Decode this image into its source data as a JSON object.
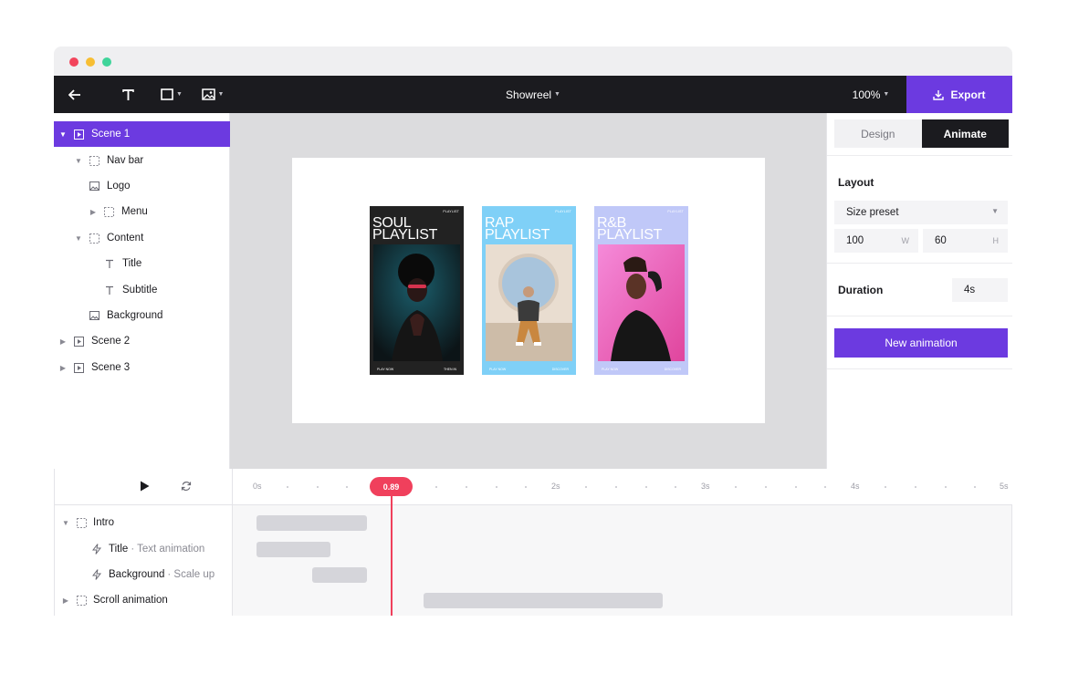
{
  "toolbar": {
    "doc_title": "Showreel",
    "zoom": "100%",
    "export_label": "Export",
    "colors": {
      "bar": "#1b1b1f",
      "accent": "#6c3ae0"
    }
  },
  "layers": {
    "items": [
      {
        "label": "Scene 1"
      },
      {
        "label": "Nav bar"
      },
      {
        "label": "Logo"
      },
      {
        "label": "Menu"
      },
      {
        "label": "Content"
      },
      {
        "label": "Title"
      },
      {
        "label": "Subtitle"
      },
      {
        "label": "Background"
      },
      {
        "label": "Scene 2"
      },
      {
        "label": "Scene 3"
      }
    ]
  },
  "canvas": {
    "cards": [
      {
        "title_line1": "SOUL",
        "title_line2": "PLAYLIST",
        "top_text": "PLAYLIST",
        "foot_left": "PLAY NOW",
        "foot_right": "THEN IN",
        "bg": "#222222"
      },
      {
        "title_line1": "RAP",
        "title_line2": "PLAYLIST",
        "top_text": "PLAYLIST",
        "foot_left": "PLAY NOW",
        "foot_right": "DISCOVER",
        "bg": "#7fd0f7"
      },
      {
        "title_line1": "R&B",
        "title_line2": "PLAYLIST",
        "top_text": "PLAYLIST",
        "foot_left": "PLAY NOW",
        "foot_right": "DISCOVER",
        "bg": "#c0c8f8"
      }
    ]
  },
  "props": {
    "tabs": [
      "Design",
      "Animate"
    ],
    "active_tab": "Animate",
    "layout_label": "Layout",
    "size_preset": "Size preset",
    "width": "100",
    "width_unit": "W",
    "height": "60",
    "height_unit": "H",
    "duration_label": "Duration",
    "duration": "4s",
    "new_animation": "New animation"
  },
  "timeline": {
    "ticks": [
      "0s",
      "2s",
      "3s",
      "4s",
      "5s"
    ],
    "playhead": "0.89",
    "rows": [
      {
        "label": "Intro",
        "sub": ""
      },
      {
        "label": "Title",
        "sub": "· Text animation"
      },
      {
        "label": "Background",
        "sub": "· Scale up"
      },
      {
        "label": "Scroll animation",
        "sub": ""
      }
    ]
  }
}
